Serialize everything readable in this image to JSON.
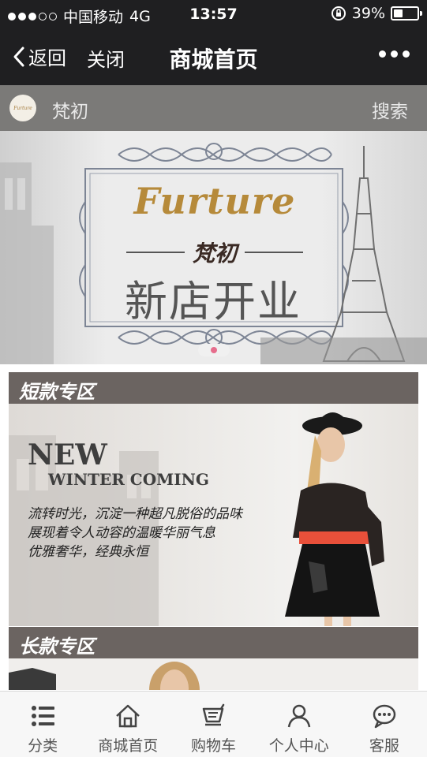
{
  "status_bar": {
    "carrier": "中国移动",
    "network": "4G",
    "time": "13:57",
    "battery": "39%",
    "battery_level": 0.39,
    "signal_bars": 3,
    "signal_total": 5
  },
  "nav": {
    "back_label": "返回",
    "close_label": "关闭",
    "title": "商城首页"
  },
  "shop": {
    "logo_text": "Furture",
    "name": "梵初",
    "search_label": "搜索"
  },
  "banner": {
    "brand": "Furture",
    "sub": "梵初",
    "headline": "新店开业",
    "slide_count": 1,
    "active_slide": 0
  },
  "sections": [
    {
      "title": "短款专区",
      "promo_title": "NEW",
      "promo_sub": "WINTER COMING",
      "promo_lines": [
        "流转时光，沉淀一种超凡脱俗的品味",
        "展现着令人动容的温暖华丽气息",
        "优雅奢华，经典永恒"
      ]
    },
    {
      "title": "长款专区"
    }
  ],
  "tabs": [
    {
      "label": "分类",
      "icon": "list-icon"
    },
    {
      "label": "商城首页",
      "icon": "home-icon"
    },
    {
      "label": "购物车",
      "icon": "cart-icon"
    },
    {
      "label": "个人中心",
      "icon": "user-icon"
    },
    {
      "label": "客服",
      "icon": "chat-icon"
    }
  ],
  "colors": {
    "nav_bg": "#1f1f21",
    "shop_bar_bg": "#7b7a78",
    "section_header_bg": "#6b6461",
    "brand_gold": "#b68a3a",
    "dot_active": "#e66d8c"
  }
}
